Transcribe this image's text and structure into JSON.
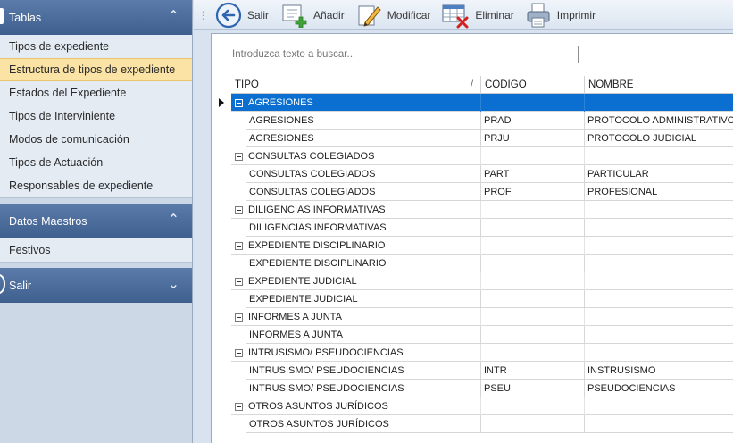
{
  "sidebar": {
    "groups": [
      {
        "title": "Tablas",
        "expanded": true,
        "items": [
          {
            "label": "Tipos de expediente"
          },
          {
            "label": "Estructura de tipos de expediente",
            "active": true
          },
          {
            "label": "Estados del Expediente"
          },
          {
            "label": "Tipos de Interviniente"
          },
          {
            "label": "Modos de comunicación"
          },
          {
            "label": "Tipos de Actuación"
          },
          {
            "label": "Responsables de expediente"
          }
        ]
      },
      {
        "title": "Datos Maestros",
        "expanded": true,
        "items": [
          {
            "label": "Festivos"
          }
        ]
      },
      {
        "title": "Salir",
        "expanded": false,
        "items": []
      }
    ]
  },
  "toolbar": {
    "exit_label": "Salir",
    "add_label": "Añadir",
    "edit_label": "Modificar",
    "delete_label": "Eliminar",
    "print_label": "Imprimir"
  },
  "search": {
    "placeholder": "Introduzca texto a buscar..."
  },
  "grid": {
    "columns": {
      "tipo": "TIPO",
      "codigo": "CODIGO",
      "nombre": "NOMBRE"
    },
    "groups": [
      {
        "label": "AGRESIONES",
        "selected": true,
        "rows": [
          {
            "tipo": "AGRESIONES",
            "codigo": "PRAD",
            "nombre": "PROTOCOLO ADMINISTRATIVO"
          },
          {
            "tipo": "AGRESIONES",
            "codigo": "PRJU",
            "nombre": "PROTOCOLO JUDICIAL"
          }
        ]
      },
      {
        "label": "CONSULTAS COLEGIADOS",
        "rows": [
          {
            "tipo": "CONSULTAS COLEGIADOS",
            "codigo": "PART",
            "nombre": "PARTICULAR"
          },
          {
            "tipo": "CONSULTAS COLEGIADOS",
            "codigo": "PROF",
            "nombre": "PROFESIONAL"
          }
        ]
      },
      {
        "label": "DILIGENCIAS INFORMATIVAS",
        "rows": [
          {
            "tipo": "DILIGENCIAS INFORMATIVAS",
            "codigo": "",
            "nombre": ""
          }
        ]
      },
      {
        "label": "EXPEDIENTE DISCIPLINARIO",
        "rows": [
          {
            "tipo": "EXPEDIENTE DISCIPLINARIO",
            "codigo": "",
            "nombre": ""
          }
        ]
      },
      {
        "label": "EXPEDIENTE JUDICIAL",
        "rows": [
          {
            "tipo": "EXPEDIENTE JUDICIAL",
            "codigo": "",
            "nombre": ""
          }
        ]
      },
      {
        "label": "INFORMES A JUNTA",
        "rows": [
          {
            "tipo": "INFORMES A JUNTA",
            "codigo": "",
            "nombre": ""
          }
        ]
      },
      {
        "label": "INTRUSISMO/ PSEUDOCIENCIAS",
        "rows": [
          {
            "tipo": "INTRUSISMO/ PSEUDOCIENCIAS",
            "codigo": "INTR",
            "nombre": "INSTRUSISMO"
          },
          {
            "tipo": "INTRUSISMO/ PSEUDOCIENCIAS",
            "codigo": "PSEU",
            "nombre": "PSEUDOCIENCIAS"
          }
        ]
      },
      {
        "label": "OTROS ASUNTOS JURÍDICOS",
        "rows": [
          {
            "tipo": "OTROS ASUNTOS JURÍDICOS",
            "codigo": "",
            "nombre": ""
          }
        ]
      }
    ]
  }
}
